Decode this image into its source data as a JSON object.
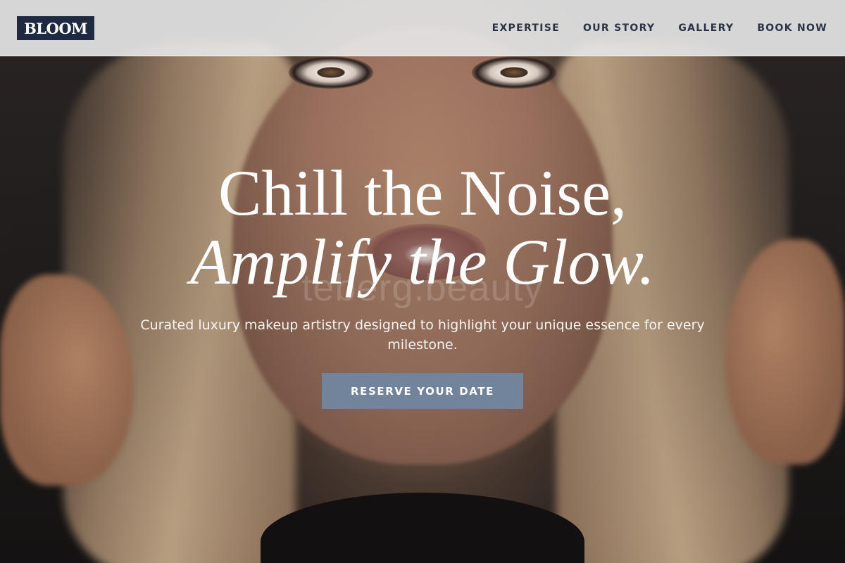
{
  "brand": {
    "logo_text": "BLOOM",
    "logo_bg": "#1f2a40",
    "logo_fg": "#ffffff"
  },
  "nav": {
    "items": [
      {
        "label": "EXPERTISE"
      },
      {
        "label": "OUR STORY"
      },
      {
        "label": "GALLERY"
      },
      {
        "label": "BOOK NOW"
      }
    ]
  },
  "hero": {
    "headline_line1": "Chill the Noise,",
    "headline_line2": "Amplify the Glow.",
    "watermark": "teberg.beauty",
    "subtitle": "Curated luxury makeup artistry designed to highlight your unique essence for every milestone.",
    "cta_label": "RESERVE YOUR DATE",
    "cta_color": "#72839c"
  }
}
